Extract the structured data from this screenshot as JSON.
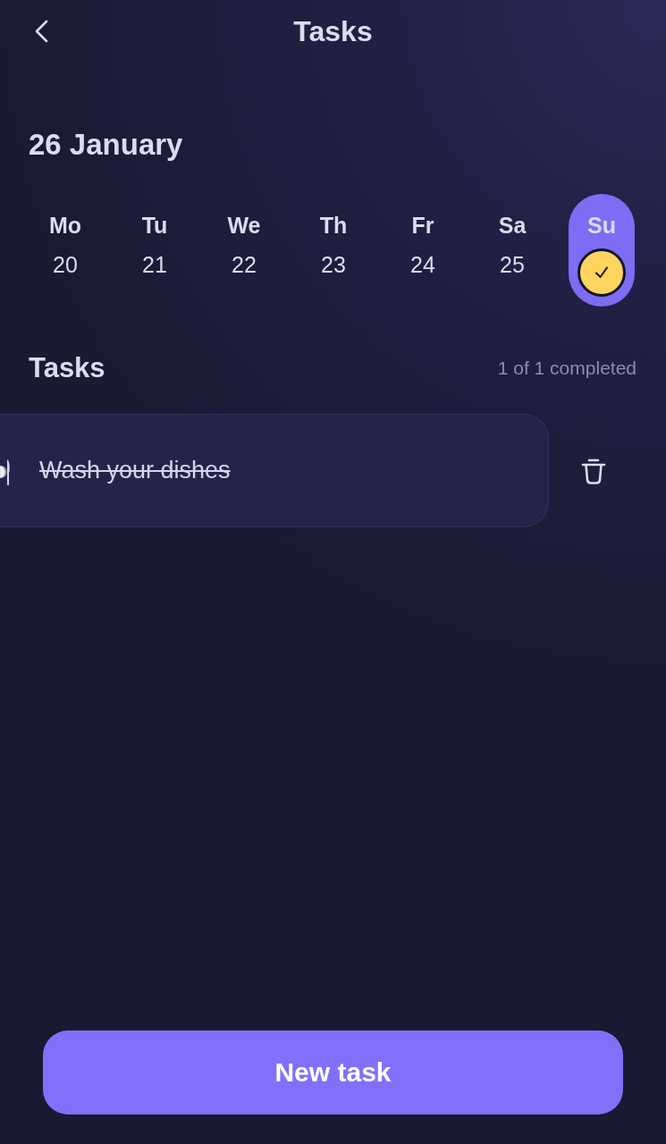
{
  "header": {
    "title": "Tasks"
  },
  "date_heading": "26 January",
  "days": [
    {
      "label": "Mo",
      "date": "20",
      "selected": false,
      "completed": false
    },
    {
      "label": "Tu",
      "date": "21",
      "selected": false,
      "completed": false
    },
    {
      "label": "We",
      "date": "22",
      "selected": false,
      "completed": false
    },
    {
      "label": "Th",
      "date": "23",
      "selected": false,
      "completed": false
    },
    {
      "label": "Fr",
      "date": "24",
      "selected": false,
      "completed": false
    },
    {
      "label": "Sa",
      "date": "25",
      "selected": false,
      "completed": false
    },
    {
      "label": "Su",
      "selected": true,
      "completed": true
    }
  ],
  "tasks_section": {
    "title": "Tasks",
    "summary": "1 of 1 completed"
  },
  "tasks": [
    {
      "title": "Wash your dishes",
      "completed": true,
      "swiped": true
    }
  ],
  "new_task_button": "New task"
}
